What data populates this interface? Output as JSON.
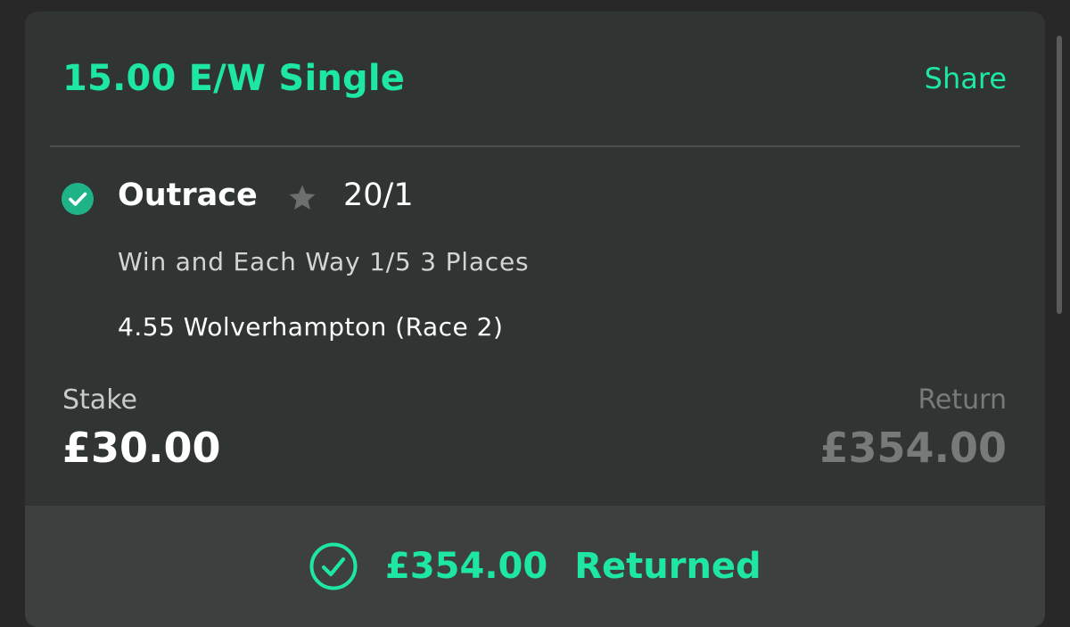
{
  "colors": {
    "accent": "#1ee7a3",
    "background": "#272827",
    "card": "#303432",
    "footer": "#3e403f",
    "muted": "#777a79"
  },
  "header": {
    "title": "15.00 E/W Single",
    "share_label": "Share"
  },
  "selection": {
    "status_icon": "check-circle-filled-icon",
    "runner": "Outrace",
    "favourite_icon": "star-icon",
    "odds": "20/1",
    "market": "Win and Each Way 1/5 3 Places",
    "event": "4.55 Wolverhampton (Race 2)"
  },
  "stake": {
    "label": "Stake",
    "value": "£30.00"
  },
  "return": {
    "label": "Return",
    "value": "£354.00"
  },
  "footer": {
    "status_icon": "check-circle-outline-icon",
    "amount": "£354.00",
    "label": "Returned"
  }
}
